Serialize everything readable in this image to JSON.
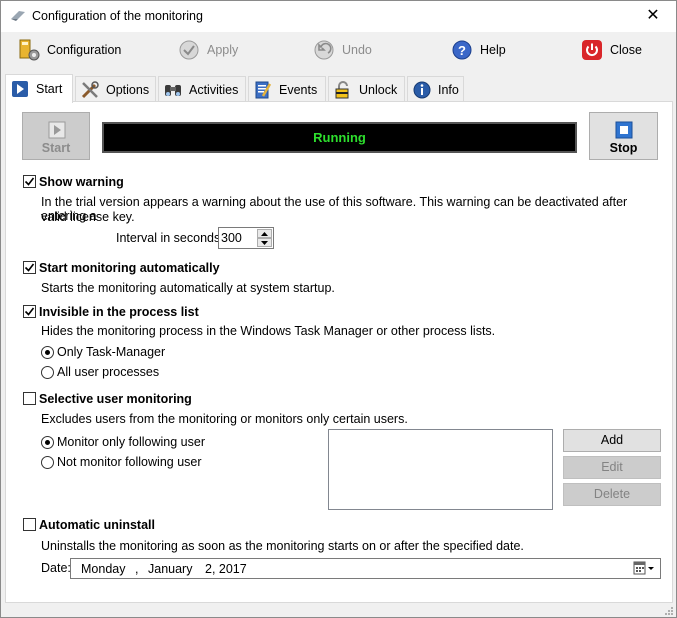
{
  "window": {
    "title": "Configuration of the monitoring",
    "close_glyph": "✕"
  },
  "toolbar": {
    "configuration": {
      "label": "Configuration",
      "icon": "configuration-icon"
    },
    "apply": {
      "label": "Apply",
      "icon": "apply-icon"
    },
    "undo": {
      "label": "Undo",
      "icon": "undo-icon"
    },
    "help": {
      "label": "Help",
      "icon": "help-icon"
    },
    "close": {
      "label": "Close",
      "icon": "power-icon"
    }
  },
  "tabs": [
    {
      "label": "Start",
      "icon": "play-icon"
    },
    {
      "label": "Options",
      "icon": "tools-icon"
    },
    {
      "label": "Activities",
      "icon": "binoculars-icon"
    },
    {
      "label": "Events",
      "icon": "notepad-icon"
    },
    {
      "label": "Unlock",
      "icon": "padlock-icon"
    },
    {
      "label": "Info",
      "icon": "info-icon"
    }
  ],
  "control": {
    "start_label": "Start",
    "status": "Running",
    "stop_label": "Stop",
    "status_color": "#2ddf2d"
  },
  "show_warning": {
    "label": "Show warning",
    "checked": true,
    "desc_line1": "In the trial version appears a warning about the use of this software. This warning can be deactivated after entering a",
    "desc_line2": "valid license key.",
    "interval_label": "Interval in seconds:",
    "interval_value": "300"
  },
  "start_auto": {
    "label": "Start monitoring automatically",
    "checked": true,
    "desc": "Starts the monitoring automatically at system startup."
  },
  "invisible": {
    "label": "Invisible in the process list",
    "checked": true,
    "desc": "Hides the monitoring process in the Windows Task Manager or other process lists.",
    "options": [
      "Only Task-Manager",
      "All user processes"
    ],
    "selected": 0
  },
  "selective": {
    "label": "Selective user monitoring",
    "checked": false,
    "desc": "Excludes users from the monitoring or monitors only certain users.",
    "options": [
      "Monitor only following user",
      "Not monitor following user"
    ],
    "selected": 0,
    "add_label": "Add",
    "edit_label": "Edit",
    "delete_label": "Delete"
  },
  "auto_uninstall": {
    "label": "Automatic uninstall",
    "checked": false,
    "desc": "Uninstalls the monitoring as soon as the monitoring starts on or after the specified date.",
    "date_label": "Date:",
    "date_weekday": "Monday",
    "date_sep": ",",
    "date_month": "January",
    "date_day_year": "2, 2017"
  }
}
